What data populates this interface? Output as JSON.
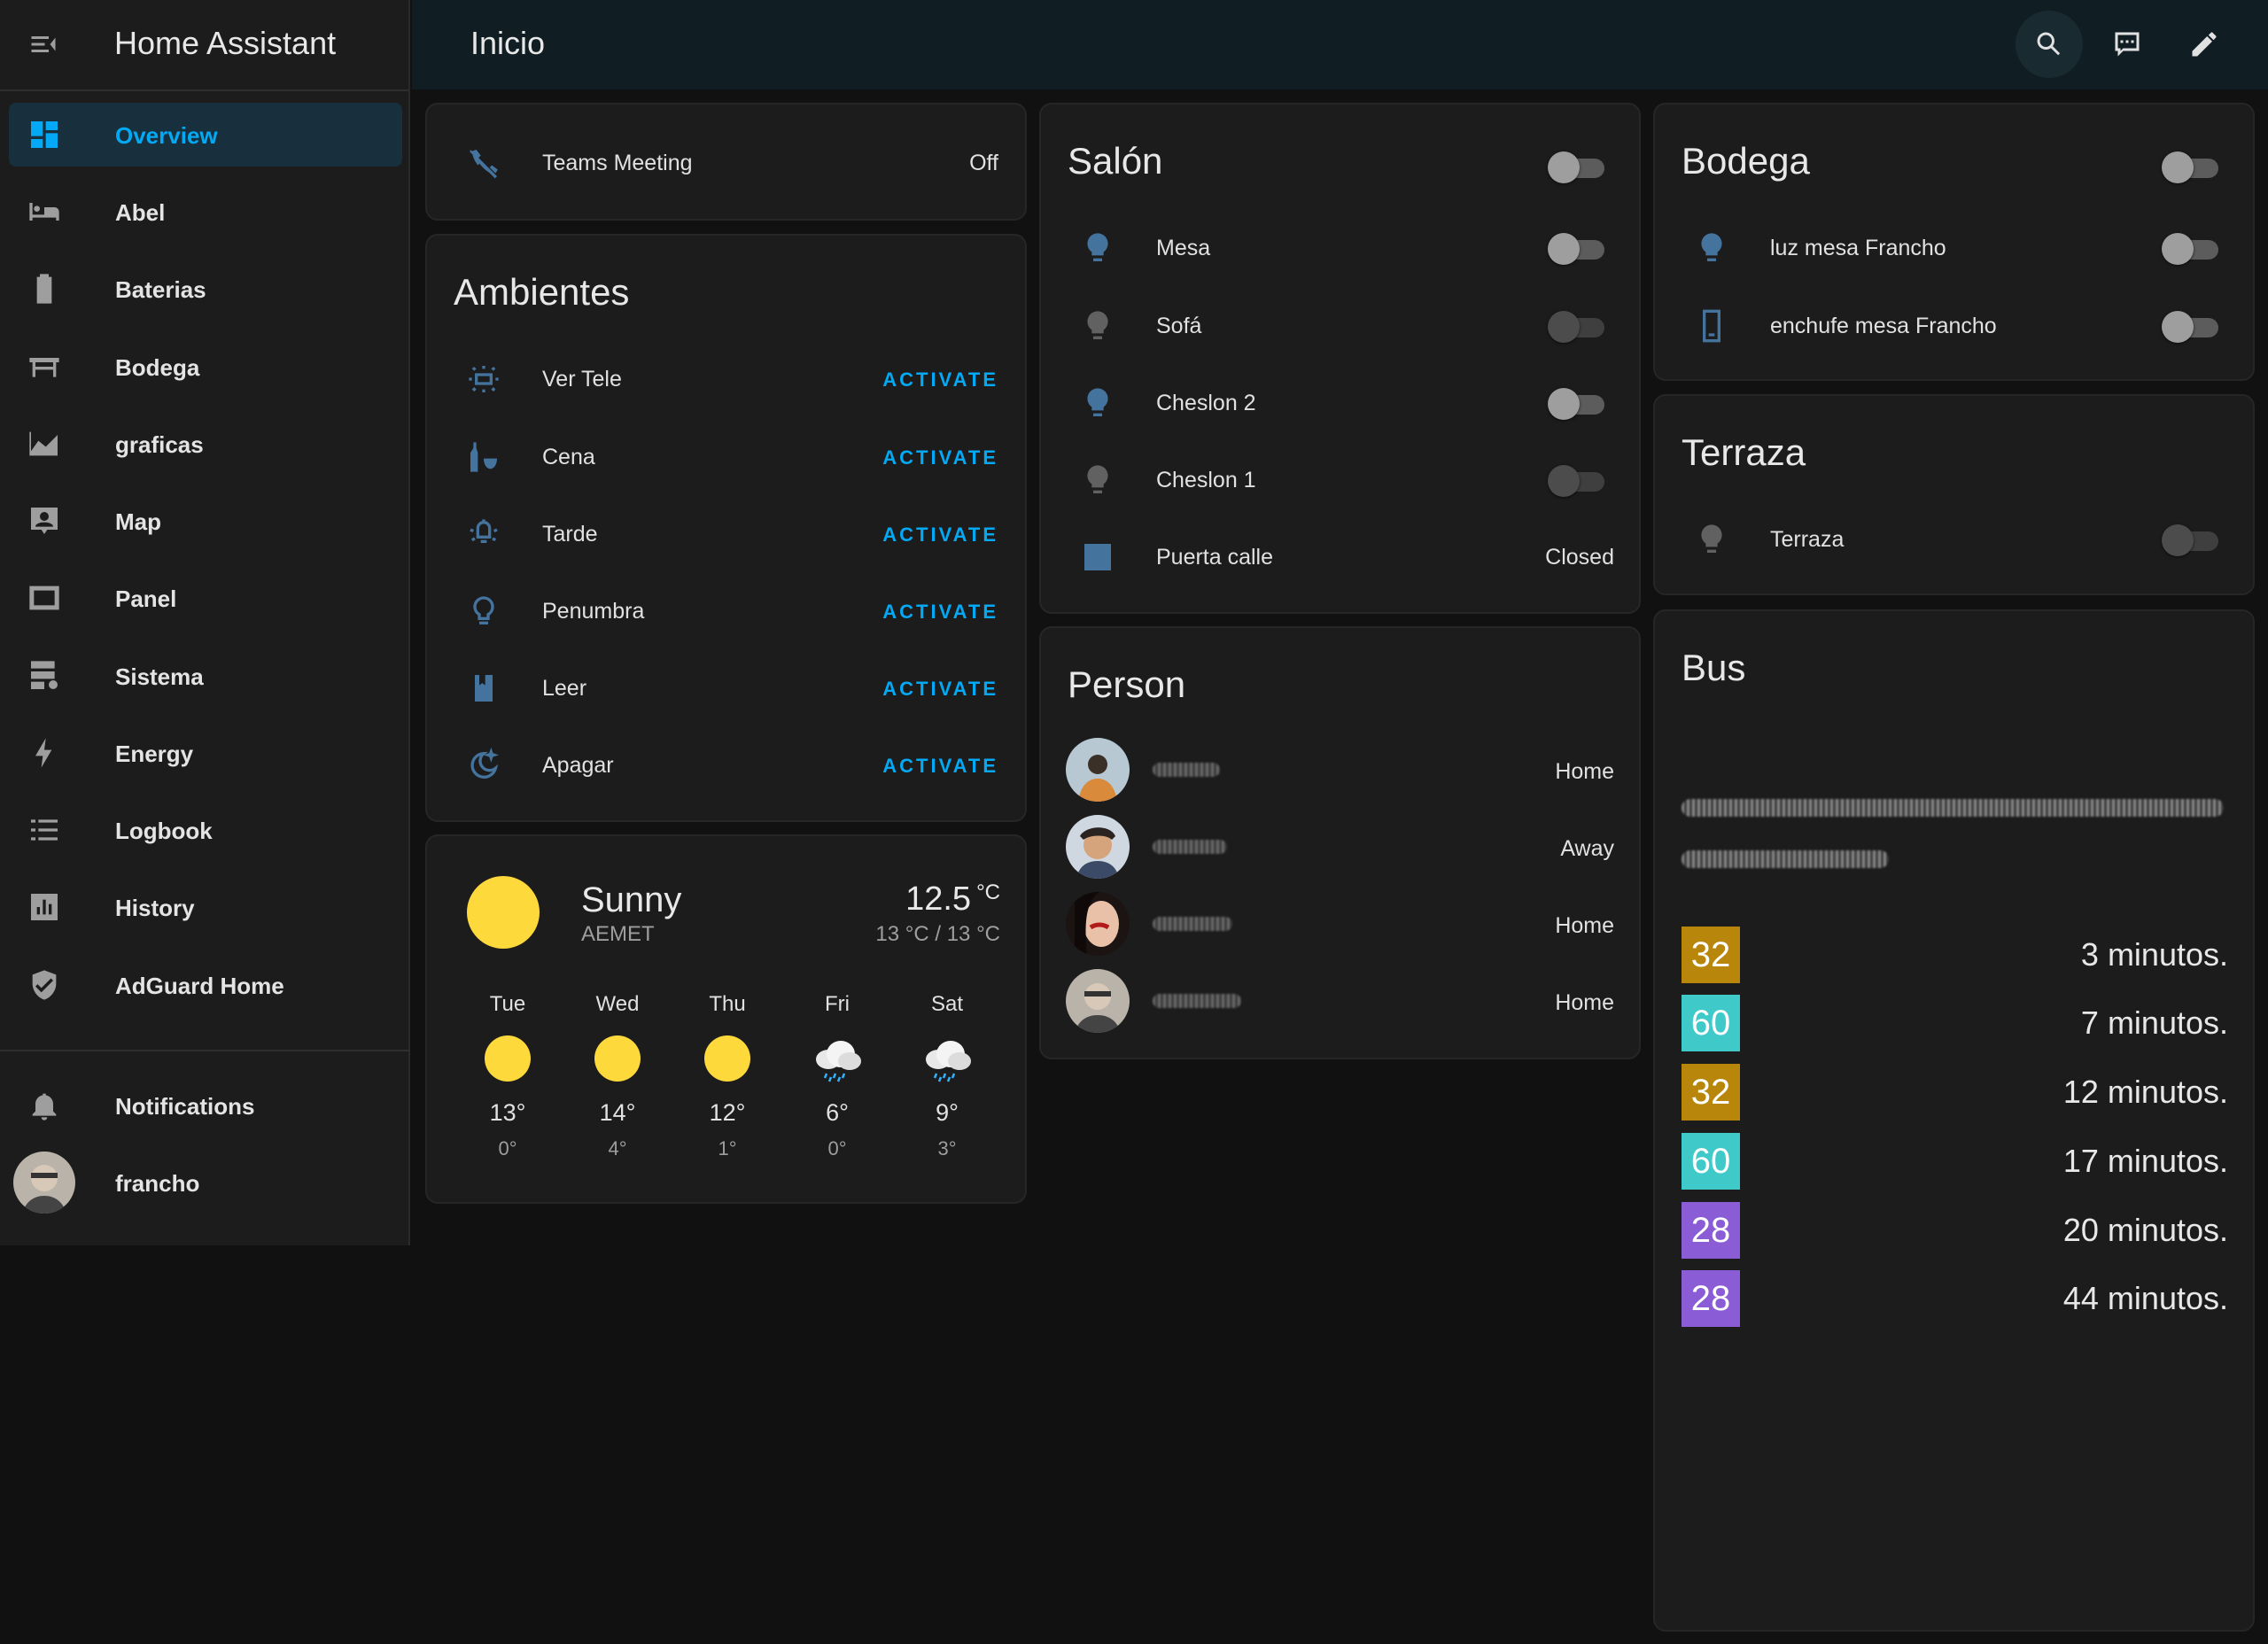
{
  "app": {
    "title": "Home Assistant"
  },
  "topbar": {
    "title": "Inicio"
  },
  "sidebar": {
    "items": [
      {
        "label": "Overview",
        "icon": "view-dashboard-icon",
        "active": true
      },
      {
        "label": "Abel",
        "icon": "bed-icon"
      },
      {
        "label": "Baterias",
        "icon": "battery-icon"
      },
      {
        "label": "Bodega",
        "icon": "table-furniture-icon"
      },
      {
        "label": "graficas",
        "icon": "chart-area-icon"
      },
      {
        "label": "Map",
        "icon": "account-box-icon"
      },
      {
        "label": "Panel",
        "icon": "monitor-frame-icon"
      },
      {
        "label": "Sistema",
        "icon": "server-settings-icon"
      },
      {
        "label": "Energy",
        "icon": "lightning-bolt-icon"
      },
      {
        "label": "Logbook",
        "icon": "format-list-bulleted-icon"
      },
      {
        "label": "History",
        "icon": "chart-box-icon"
      },
      {
        "label": "AdGuard Home",
        "icon": "shield-check-icon"
      }
    ],
    "notifications_label": "Notifications",
    "user_label": "francho"
  },
  "teams": {
    "label": "Teams Meeting",
    "state": "Off",
    "icon": "phone-off-icon"
  },
  "ambientes": {
    "title": "Ambientes",
    "scenes": [
      {
        "label": "Ver Tele",
        "action": "ACTIVATE",
        "icon": "television-ambient-light-icon"
      },
      {
        "label": "Cena",
        "action": "ACTIVATE",
        "icon": "glass-mug-icon"
      },
      {
        "label": "Tarde",
        "action": "ACTIVATE",
        "icon": "ceiling-light-icon"
      },
      {
        "label": "Penumbra",
        "action": "ACTIVATE",
        "icon": "lightbulb-outline-icon"
      },
      {
        "label": "Leer",
        "action": "ACTIVATE",
        "icon": "book-icon"
      },
      {
        "label": "Apagar",
        "action": "ACTIVATE",
        "icon": "weather-night-icon"
      }
    ]
  },
  "weather": {
    "condition": "Sunny",
    "source": "AEMET",
    "temp": "12.5",
    "unit": "°C",
    "range": "13 °C / 13 °C",
    "forecast": [
      {
        "day": "Tue",
        "hi": "13°",
        "lo": "0°",
        "icon": "sunny"
      },
      {
        "day": "Wed",
        "hi": "14°",
        "lo": "4°",
        "icon": "sunny"
      },
      {
        "day": "Thu",
        "hi": "12°",
        "lo": "1°",
        "icon": "sunny"
      },
      {
        "day": "Fri",
        "hi": "6°",
        "lo": "0°",
        "icon": "rainy"
      },
      {
        "day": "Sat",
        "hi": "9°",
        "lo": "3°",
        "icon": "rainy"
      }
    ]
  },
  "salon": {
    "title": "Salón",
    "rows": [
      {
        "label": "Mesa",
        "type": "toggle",
        "icon": "lightbulb-icon"
      },
      {
        "label": "Sofá",
        "type": "toggle",
        "icon": "lightbulb-icon"
      },
      {
        "label": "Cheslon 2",
        "type": "toggle",
        "icon": "lightbulb-icon"
      },
      {
        "label": "Cheslon 1",
        "type": "toggle",
        "icon": "lightbulb-icon"
      },
      {
        "label": "Puerta calle",
        "type": "state",
        "state": "Closed",
        "icon": "door-square-icon"
      }
    ]
  },
  "person": {
    "title": "Person",
    "rows": [
      {
        "state": "Home"
      },
      {
        "state": "Away"
      },
      {
        "state": "Home"
      },
      {
        "state": "Home"
      }
    ]
  },
  "bodega": {
    "title": "Bodega",
    "rows": [
      {
        "label": "luz mesa Francho",
        "icon": "lightbulb-icon"
      },
      {
        "label": "enchufe mesa Francho",
        "icon": "cellphone-icon"
      }
    ]
  },
  "terraza": {
    "title": "Terraza",
    "rows": [
      {
        "label": "Terraza",
        "icon": "lightbulb-icon"
      }
    ]
  },
  "bus": {
    "title": "Bus",
    "arrivals": [
      {
        "line": "32",
        "time": "3 minutos.",
        "color": "#b8860b"
      },
      {
        "line": "60",
        "time": "7 minutos.",
        "color": "#40c9c9"
      },
      {
        "line": "32",
        "time": "12 minutos.",
        "color": "#b8860b"
      },
      {
        "line": "60",
        "time": "17 minutos.",
        "color": "#40c9c9"
      },
      {
        "line": "28",
        "time": "20 minutos.",
        "color": "#8a5cd6"
      },
      {
        "line": "28",
        "time": "44 minutos.",
        "color": "#8a5cd6"
      }
    ]
  },
  "colors": {
    "accent": "#03a9f4",
    "icon_blue": "#44739e",
    "sun": "#fdd93c"
  }
}
